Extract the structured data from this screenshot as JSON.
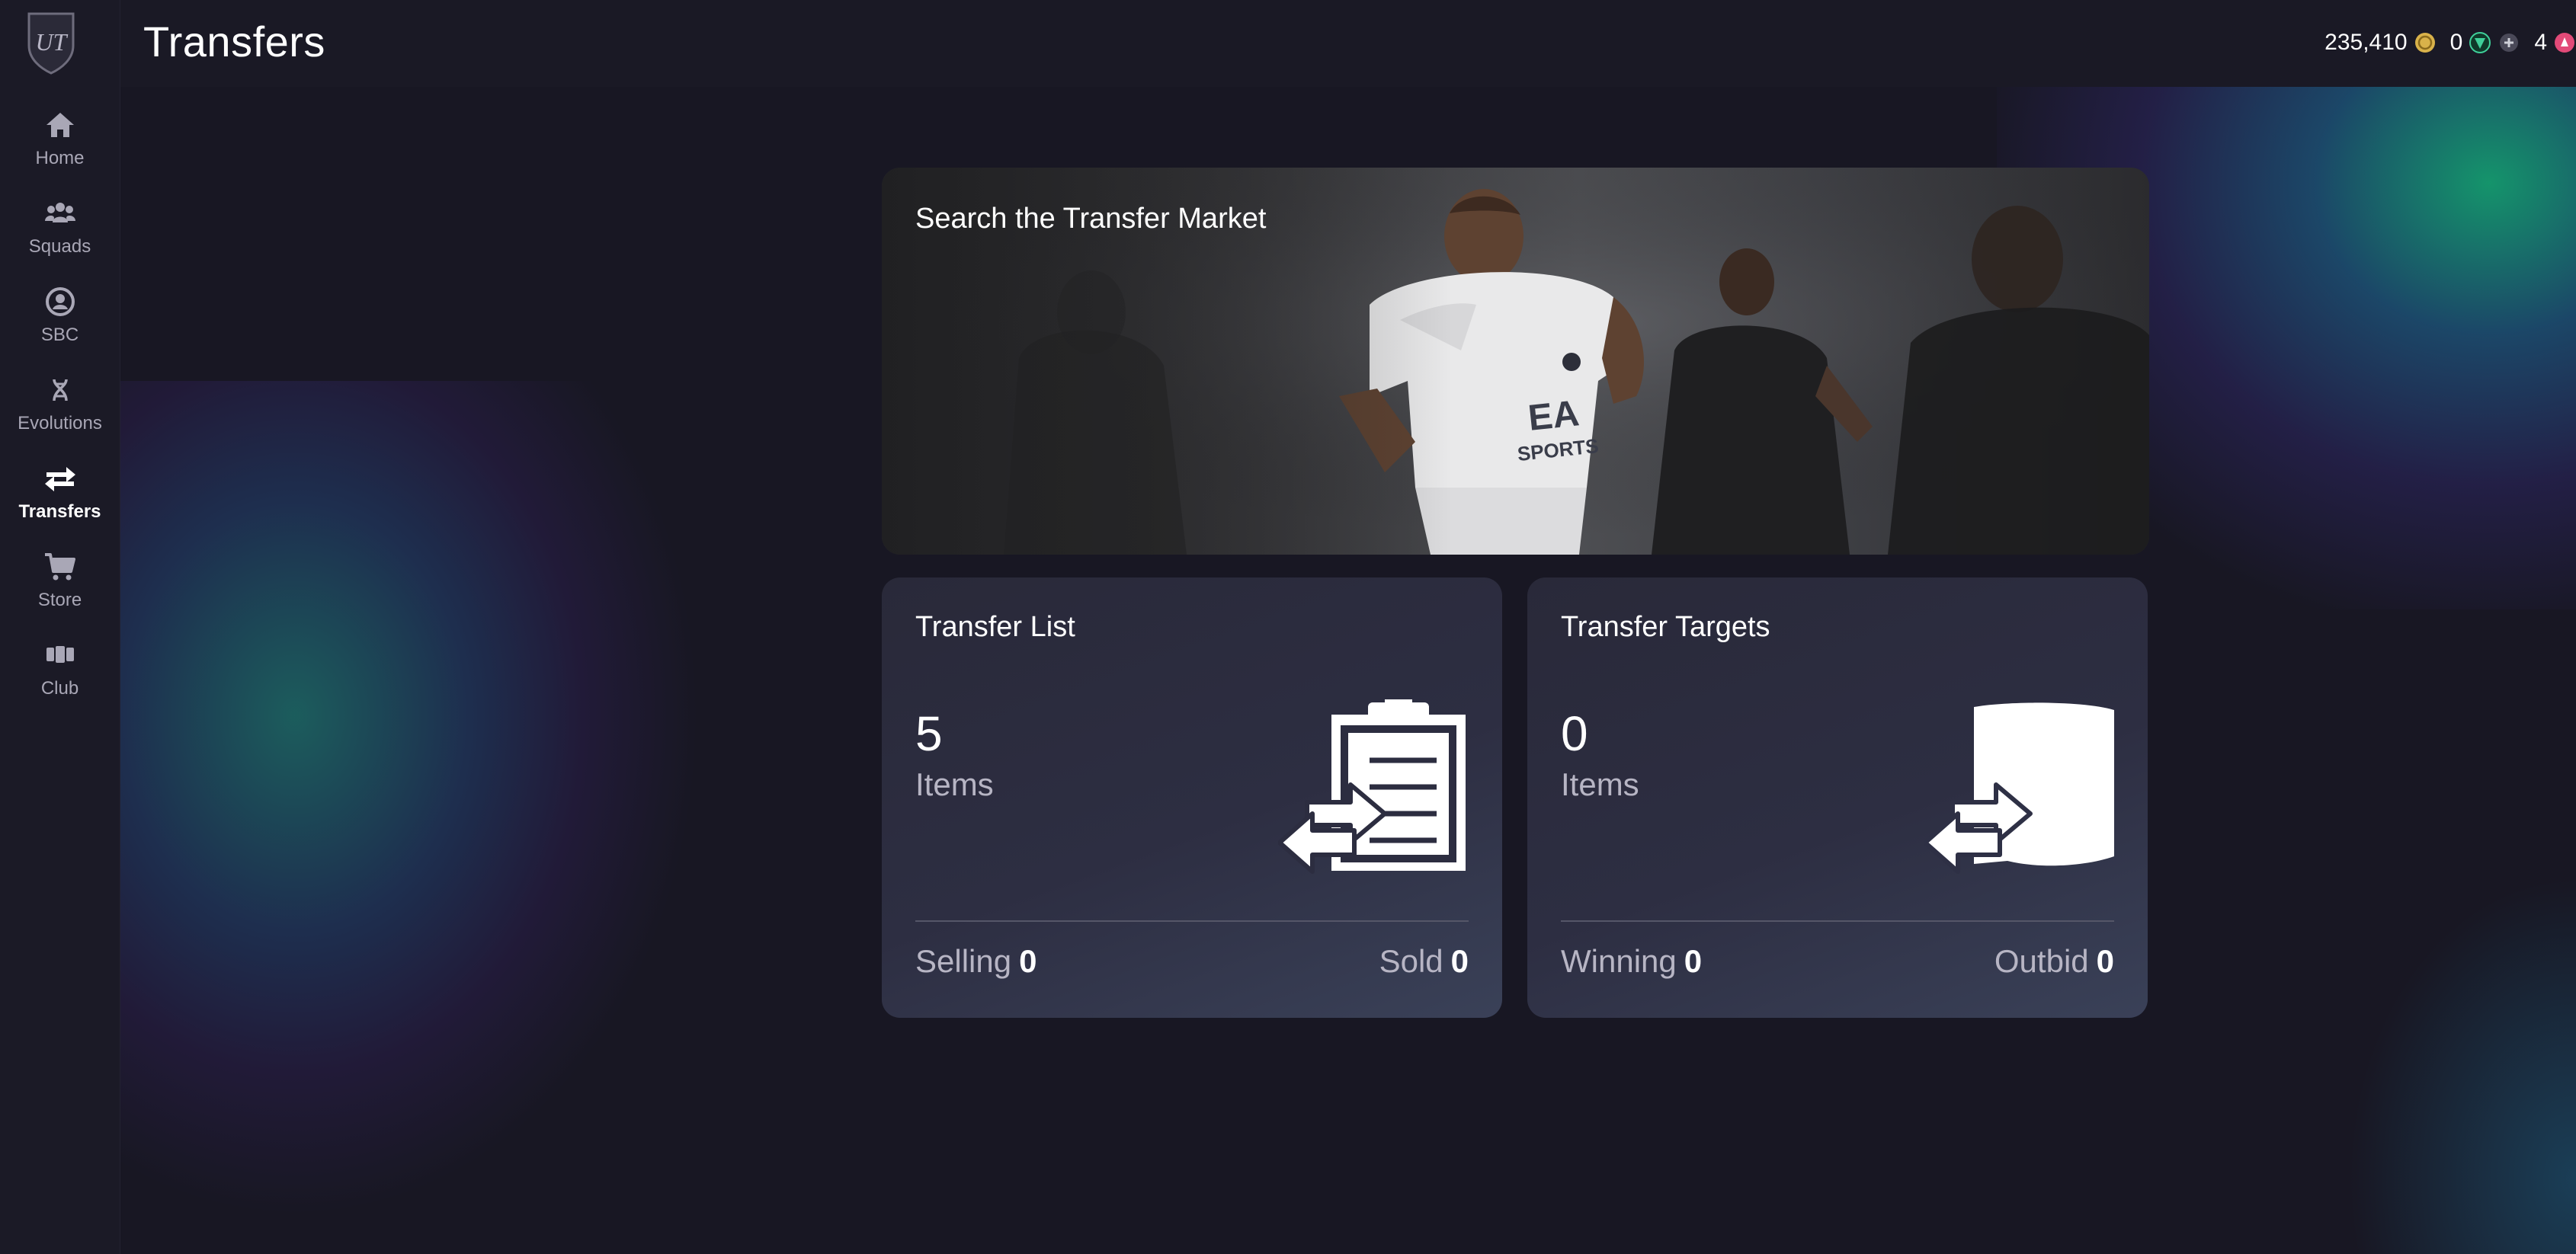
{
  "header": {
    "title": "Transfers",
    "currencies": [
      {
        "value": "235,410",
        "icon": "coin-icon",
        "color": "#d9b24a"
      },
      {
        "value": "0",
        "icon": "fc-points-icon",
        "color": "#3fd09a"
      },
      {
        "value": "4",
        "icon": "sbc-token-icon",
        "color": "#e24a78"
      }
    ]
  },
  "sidebar": {
    "items": [
      {
        "label": "Home",
        "icon": "home-icon",
        "active": false
      },
      {
        "label": "Squads",
        "icon": "squads-icon",
        "active": false
      },
      {
        "label": "SBC",
        "icon": "sbc-icon",
        "active": false
      },
      {
        "label": "Evolutions",
        "icon": "evolutions-icon",
        "active": false
      },
      {
        "label": "Transfers",
        "icon": "transfers-icon",
        "active": true
      },
      {
        "label": "Store",
        "icon": "store-icon",
        "active": false
      },
      {
        "label": "Club",
        "icon": "club-icon",
        "active": false
      }
    ]
  },
  "hero": {
    "title": "Search the Transfer Market"
  },
  "cards": {
    "transfer_list": {
      "title": "Transfer List",
      "count": "5",
      "count_label": "Items",
      "stat_left_label": "Selling",
      "stat_left_value": "0",
      "stat_right_label": "Sold",
      "stat_right_value": "0",
      "icon": "clipboard-transfer-icon"
    },
    "transfer_targets": {
      "title": "Transfer Targets",
      "count": "0",
      "count_label": "Items",
      "stat_left_label": "Winning",
      "stat_left_value": "0",
      "stat_right_label": "Outbid",
      "stat_right_value": "0",
      "icon": "card-transfer-icon"
    }
  }
}
